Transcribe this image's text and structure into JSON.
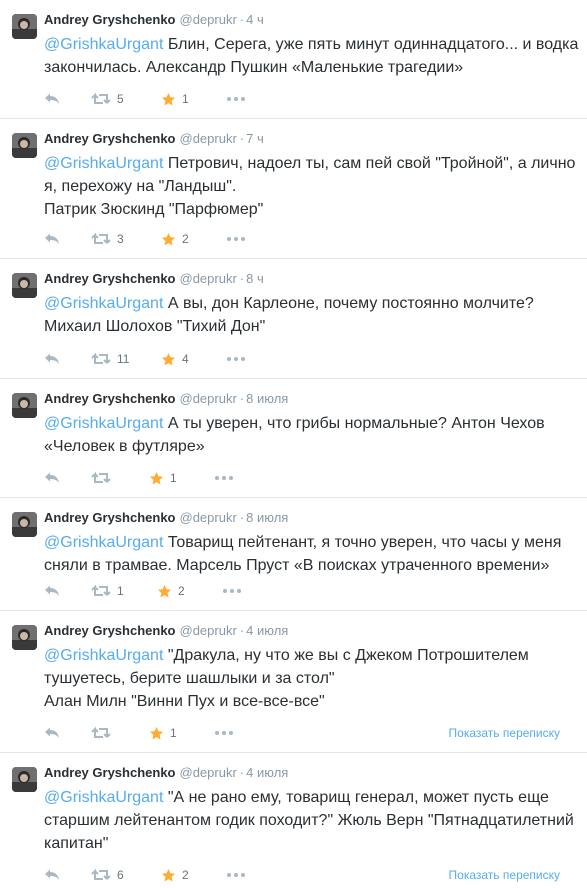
{
  "author": {
    "fullname": "Andrey Gryshchenko",
    "username": "@deprukr",
    "separator": "·"
  },
  "tweets": [
    {
      "time": "4 ч",
      "mention": "@GrishkaUrgant",
      "lines": [
        " Блин, Серега, уже пять минут одиннадцатого... и водка",
        "закончилась. Александр Пушкин «Маленькие трагедии»"
      ],
      "retweets": "5",
      "favorites": "1",
      "conversation": ""
    },
    {
      "time": "7 ч",
      "mention": "@GrishkaUrgant",
      "lines": [
        " Петрович, надоел ты, сам пей свой \"Тройной\",  а  лично",
        "я, перехожу на \"Ландыш\".",
        "Патрик Зюскинд \"Парфюмер\""
      ],
      "retweets": "3",
      "favorites": "2",
      "conversation": ""
    },
    {
      "time": "8 ч",
      "mention": "@GrishkaUrgant",
      "lines": [
        " А вы, дон Карлеоне, почему постоянно молчите?",
        "Михаил Шолохов \"Тихий Дон\""
      ],
      "retweets": "11",
      "favorites": "4",
      "conversation": ""
    },
    {
      "time": "8 июля",
      "mention": "@GrishkaUrgant",
      "lines": [
        " А ты уверен, что грибы нормальные? Антон Чехов",
        "«Человек в футляре»"
      ],
      "retweets": "",
      "favorites": "1",
      "conversation": ""
    },
    {
      "time": "8 июля",
      "mention": "@GrishkaUrgant",
      "lines": [
        " Товарищ пейтенант, я точно уверен, что часы у меня",
        "сняли в трамвае. Марсель Пруст «В поисках утраченного времени»"
      ],
      "retweets": "1",
      "favorites": "2",
      "conversation": ""
    },
    {
      "time": "4 июля",
      "mention": "@GrishkaUrgant",
      "lines": [
        " \"Дракула, ну что же вы с Джеком Потрошителем",
        "тушуетесь, берите шашлыки и за стол\"",
        "Алан Милн \"Винни Пух и все-все-все\""
      ],
      "retweets": "",
      "favorites": "1",
      "conversation": "Показать переписку"
    },
    {
      "time": "4 июля",
      "mention": "@GrishkaUrgant",
      "lines": [
        " \"А не рано ему, товарищ генерал, может пусть еще",
        "старшим лейтенантом годик походит?\" Жюль Верн \"Пятнадцатилетний",
        "капитан\""
      ],
      "retweets": "6",
      "favorites": "2",
      "conversation": "Показать переписку"
    }
  ]
}
